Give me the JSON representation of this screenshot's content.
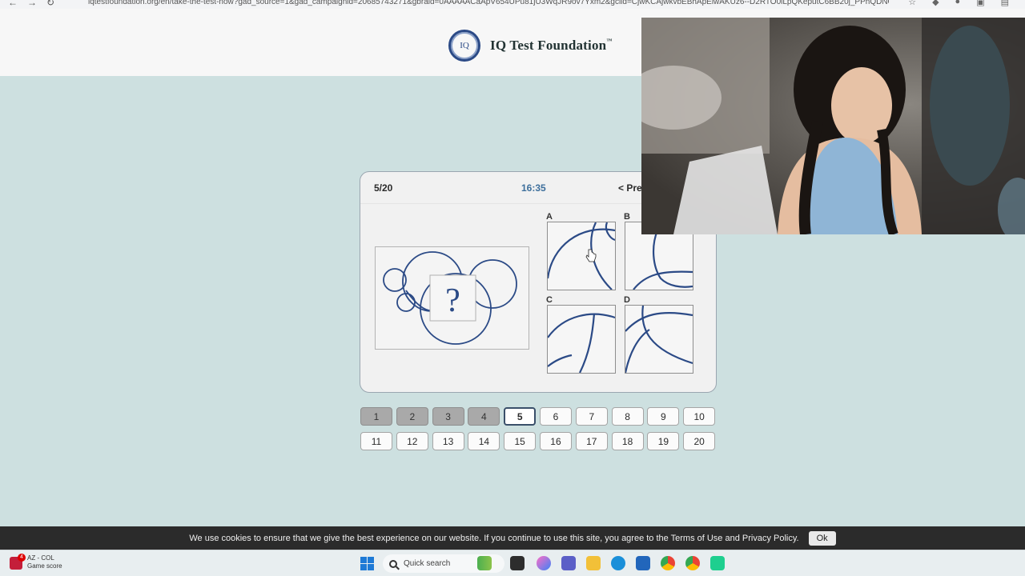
{
  "browser": {
    "url": "iqtestfoundation.org/en/take-the-test-now?gad_source=1&gad_campaignid=20685743271&gbraid=0AAAAACaApV654UPu81jU3WqJR9ov7Yxm2&gclid=CjwKCAjwkvbEBhApEiwAKUz6--D2RTO0iLpQKeputC6BB20j_PPhQDNOugb..."
  },
  "header": {
    "logo_text": "IQ",
    "brand": "IQ Test Foundation",
    "trademark": "™"
  },
  "test": {
    "progress": "5/20",
    "timer": "16:35",
    "prev_label": "< Pre",
    "question_mark": "?",
    "options": [
      {
        "letter": "A"
      },
      {
        "letter": "B"
      },
      {
        "letter": "C"
      },
      {
        "letter": "D"
      }
    ]
  },
  "pager": {
    "current": 5,
    "completed": [
      1,
      2,
      3,
      4
    ],
    "pages": [
      "1",
      "2",
      "3",
      "4",
      "5",
      "6",
      "7",
      "8",
      "9",
      "10",
      "11",
      "12",
      "13",
      "14",
      "15",
      "16",
      "17",
      "18",
      "19",
      "20"
    ]
  },
  "cookie": {
    "text": "We use cookies to ensure that we give the best experience on our website. If you continue to use this site, you agree to the Terms of Use and Privacy Policy.",
    "ok_label": "Ok"
  },
  "taskbar": {
    "widget_title": "AZ - COL",
    "widget_sub": "Game score",
    "widget_badge": "4",
    "search_placeholder": "Quick search"
  },
  "colors": {
    "page_bg": "#cde0e0",
    "figure_stroke": "#2b4a86",
    "timer": "#3d6f9c",
    "cookie_bg": "#2b2b2b"
  }
}
